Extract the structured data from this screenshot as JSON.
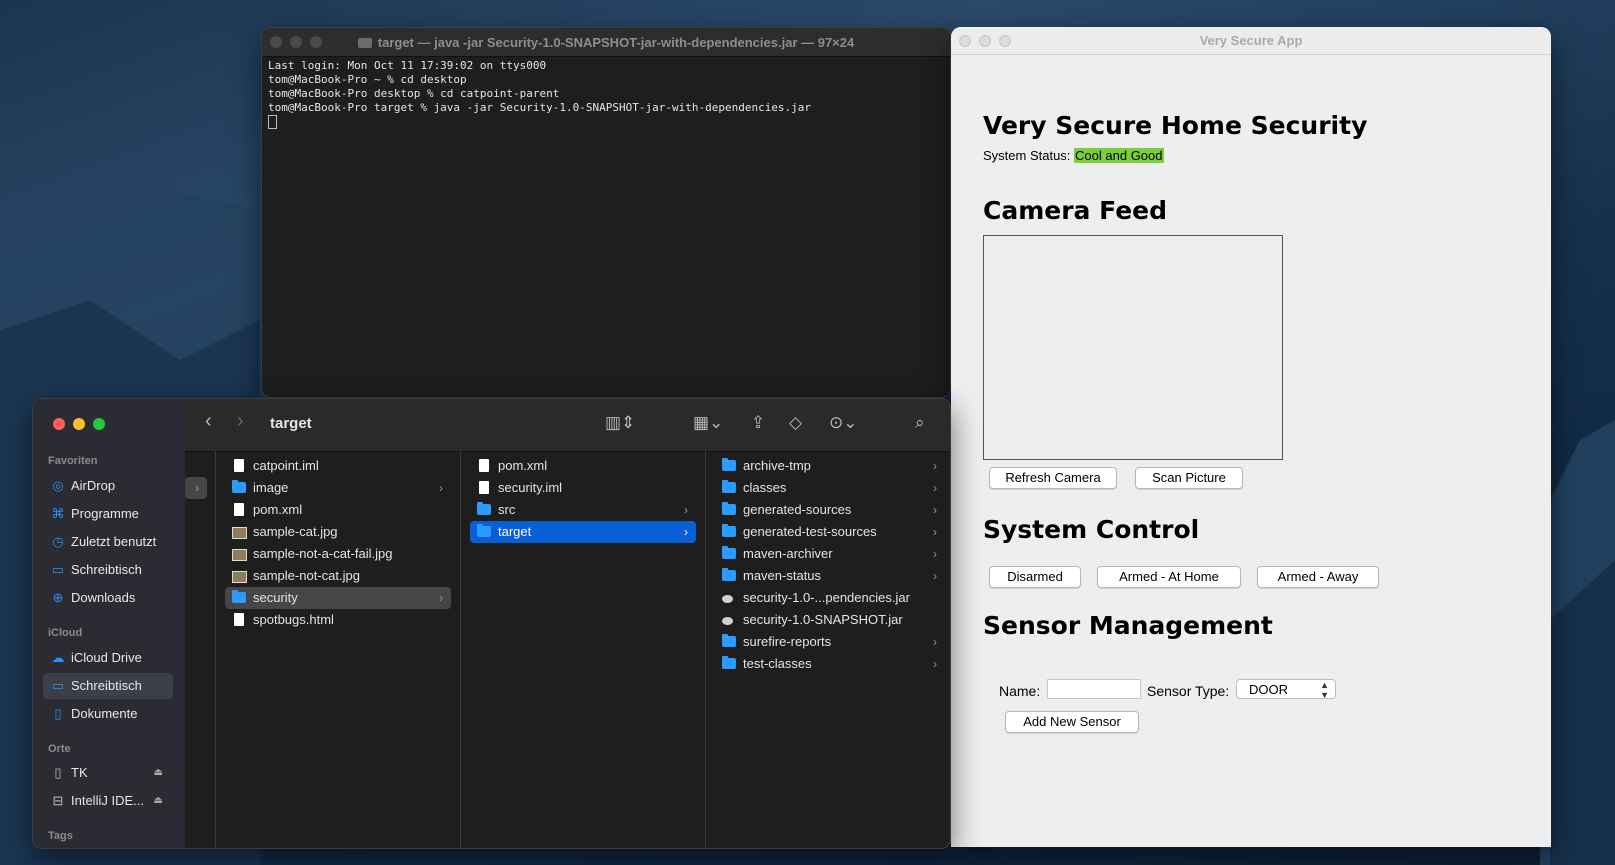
{
  "terminal": {
    "title": "target — java -jar Security-1.0-SNAPSHOT-jar-with-dependencies.jar — 97×24",
    "lines": [
      "Last login: Mon Oct 11 17:39:02 on ttys000",
      "tom@MacBook-Pro ~ % cd desktop",
      "tom@MacBook-Pro desktop % cd catpoint-parent",
      "tom@MacBook-Pro target % java -jar Security-1.0-SNAPSHOT-jar-with-dependencies.jar"
    ]
  },
  "app": {
    "window_title": "Very Secure App",
    "heading": "Very Secure Home Security",
    "status_label": "System Status:",
    "status_value": "Cool and Good",
    "status_color": "#7ccf3a",
    "camera_heading": "Camera Feed",
    "refresh_camera": "Refresh Camera",
    "scan_picture": "Scan Picture",
    "control_heading": "System Control",
    "disarmed": "Disarmed",
    "armed_home": "Armed - At Home",
    "armed_away": "Armed - Away",
    "sensor_heading": "Sensor Management",
    "name_label": "Name:",
    "name_value": "",
    "sensor_type_label": "Sensor Type:",
    "sensor_type_value": "DOOR",
    "add_sensor": "Add New Sensor"
  },
  "finder": {
    "current_folder": "target",
    "sidebar": {
      "favorites_heading": "Favoriten",
      "favorites": [
        "AirDrop",
        "Programme",
        "Zuletzt benutzt",
        "Schreibtisch",
        "Downloads"
      ],
      "icloud_heading": "iCloud",
      "icloud": [
        "iCloud Drive",
        "Schreibtisch",
        "Dokumente"
      ],
      "locations_heading": "Orte",
      "locations": [
        "TK",
        "IntelliJ IDE..."
      ],
      "tags_heading": "Tags"
    },
    "column1": [
      "catpoint.iml",
      "image",
      "pom.xml",
      "sample-cat.jpg",
      "sample-not-a-cat-fail.jpg",
      "sample-not-cat.jpg",
      "security",
      "spotbugs.html"
    ],
    "column2": [
      "pom.xml",
      "security.iml",
      "src",
      "target"
    ],
    "column3": [
      "archive-tmp",
      "classes",
      "generated-sources",
      "generated-test-sources",
      "maven-archiver",
      "maven-status",
      "security-1.0-...pendencies.jar",
      "security-1.0-SNAPSHOT.jar",
      "surefire-reports",
      "test-classes"
    ]
  }
}
